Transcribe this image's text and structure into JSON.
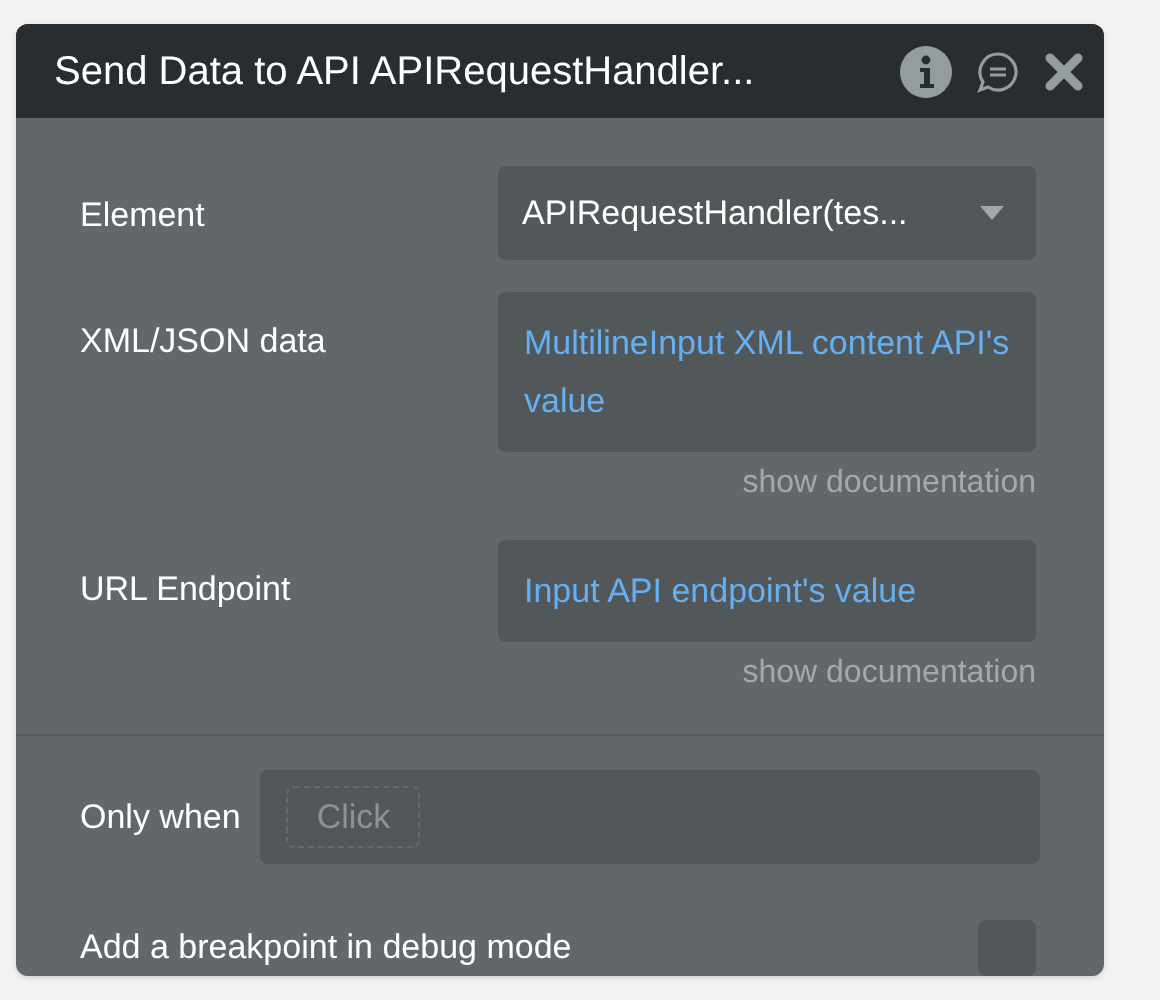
{
  "window": {
    "title": "Send Data to API APIRequestHandler..."
  },
  "fields": [
    {
      "label": "Element",
      "kind": "dropdown",
      "value": "APIRequestHandler(tes..."
    },
    {
      "label": "XML/JSON data",
      "kind": "expression",
      "value": "MultilineInput XML content API's value",
      "doc": "show documentation"
    },
    {
      "label": "URL Endpoint",
      "kind": "expression",
      "value": "Input API endpoint's value",
      "doc": "show documentation"
    }
  ],
  "condition": {
    "label": "Only when",
    "placeholder": "Click"
  },
  "breakpoint": {
    "label": "Add a breakpoint in debug mode",
    "checked": false
  }
}
